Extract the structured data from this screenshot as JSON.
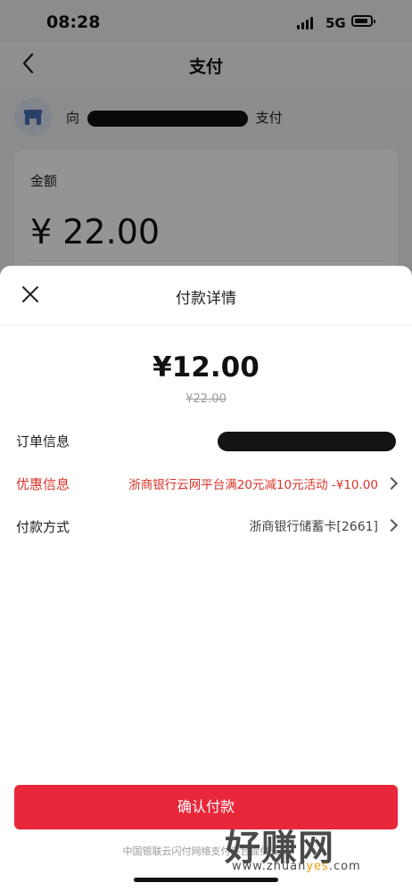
{
  "status_bar": {
    "time": "08:28",
    "network": "5G"
  },
  "nav": {
    "title": "支付"
  },
  "merchant": {
    "prefix": "向",
    "suffix": "支付"
  },
  "amount_card": {
    "label": "金额",
    "value": "¥ 22.00"
  },
  "sheet": {
    "title": "付款详情",
    "pay_amount": "¥12.00",
    "original_amount": "¥22.00",
    "order_label": "订单信息",
    "discount_label": "优惠信息",
    "discount_value": "浙商银行云网平台满20元减10元活动  -¥10.00",
    "method_label": "付款方式",
    "method_value": "浙商银行储蓄卡[2661]",
    "confirm_label": "确认付款",
    "footer": "中国银联云闪付网络支付平台提供支持"
  },
  "watermark": {
    "big": "好赚网",
    "small_pre": "www.zhuan",
    "small_mid": "yes",
    "small_post": ".com"
  },
  "colors": {
    "accent": "#e8283a",
    "discount": "#d9342b"
  },
  "icons": [
    "back-arrow-icon",
    "shop-icon",
    "close-icon",
    "chevron-right-icon",
    "signal-icon",
    "battery-icon"
  ]
}
